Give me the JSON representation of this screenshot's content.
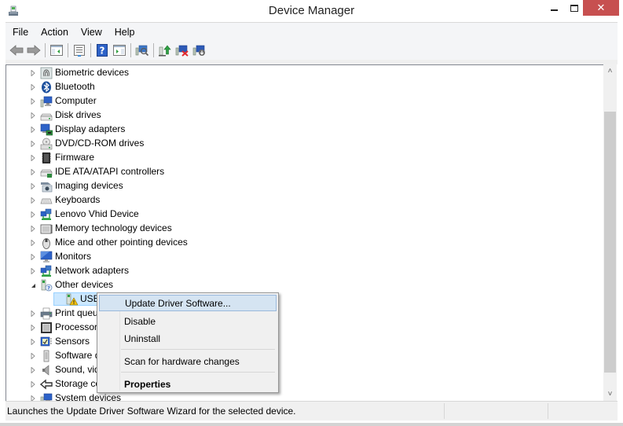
{
  "window": {
    "title": "Device Manager",
    "controls": {
      "minimize": "minimize",
      "maximize": "maximize",
      "close": "✕"
    }
  },
  "menubar": {
    "items": [
      "File",
      "Action",
      "View",
      "Help"
    ]
  },
  "toolbar": {
    "buttons": [
      {
        "name": "back",
        "icon": "back-arrow-icon"
      },
      {
        "name": "forward",
        "icon": "forward-arrow-icon"
      },
      {
        "name": "show-hide-console-tree",
        "icon": "console-tree-icon"
      },
      {
        "name": "properties",
        "icon": "properties-icon"
      },
      {
        "name": "help",
        "icon": "help-icon"
      },
      {
        "name": "show-hide-action-pane",
        "icon": "action-pane-icon"
      },
      {
        "name": "scan-hardware",
        "icon": "scan-hardware-icon"
      },
      {
        "name": "update-driver",
        "icon": "update-driver-icon"
      },
      {
        "name": "uninstall",
        "icon": "uninstall-device-icon"
      },
      {
        "name": "disable",
        "icon": "disable-device-icon"
      }
    ]
  },
  "tree": {
    "items": [
      {
        "label": "Biometric devices",
        "icon": "fingerprint-icon",
        "expanded": false
      },
      {
        "label": "Bluetooth",
        "icon": "bluetooth-icon",
        "expanded": false
      },
      {
        "label": "Computer",
        "icon": "computer-icon",
        "expanded": false
      },
      {
        "label": "Disk drives",
        "icon": "disk-drive-icon",
        "expanded": false
      },
      {
        "label": "Display adapters",
        "icon": "display-adapter-icon",
        "expanded": false
      },
      {
        "label": "DVD/CD-ROM drives",
        "icon": "dvd-drive-icon",
        "expanded": false
      },
      {
        "label": "Firmware",
        "icon": "firmware-icon",
        "expanded": false
      },
      {
        "label": "IDE ATA/ATAPI controllers",
        "icon": "ide-controller-icon",
        "expanded": false
      },
      {
        "label": "Imaging devices",
        "icon": "camera-icon",
        "expanded": false
      },
      {
        "label": "Keyboards",
        "icon": "keyboard-icon",
        "expanded": false
      },
      {
        "label": "Lenovo Vhid Device",
        "icon": "network-device-icon",
        "expanded": false
      },
      {
        "label": "Memory technology devices",
        "icon": "memory-device-icon",
        "expanded": false
      },
      {
        "label": "Mice and other pointing devices",
        "icon": "mouse-icon",
        "expanded": false
      },
      {
        "label": "Monitors",
        "icon": "monitor-icon",
        "expanded": false
      },
      {
        "label": "Network adapters",
        "icon": "network-adapter-icon",
        "expanded": false
      },
      {
        "label": "Other devices",
        "icon": "unknown-device-icon",
        "expanded": true
      },
      {
        "label": "USBas",
        "icon": "warning-device-icon",
        "child": true,
        "selected": true
      },
      {
        "label": "Print queues",
        "icon": "printer-icon",
        "expanded": false
      },
      {
        "label": "Processors",
        "icon": "processor-icon",
        "expanded": false
      },
      {
        "label": "Sensors",
        "icon": "sensor-icon",
        "expanded": false
      },
      {
        "label": "Software devices",
        "icon": "software-device-icon",
        "expanded": false
      },
      {
        "label": "Sound, video and game controllers",
        "icon": "speaker-icon",
        "expanded": false
      },
      {
        "label": "Storage controllers",
        "icon": "storage-controller-icon",
        "expanded": false
      },
      {
        "label": "System devices",
        "icon": "system-device-icon",
        "expanded": false
      }
    ]
  },
  "context_menu": {
    "items": [
      {
        "label": "Update Driver Software...",
        "highlighted": true
      },
      {
        "label": "Disable"
      },
      {
        "label": "Uninstall"
      },
      {
        "separator": true
      },
      {
        "label": "Scan for hardware changes"
      },
      {
        "separator": true
      },
      {
        "label": "Properties",
        "bold": true
      }
    ]
  },
  "statusbar": {
    "text": "Launches the Update Driver Software Wizard for the selected device."
  },
  "colors": {
    "close_button": "#c75050",
    "selection": "#cce8ff",
    "menu_highlight": "#d5e4f2",
    "scroll_thumb": "#cdcdcd"
  }
}
